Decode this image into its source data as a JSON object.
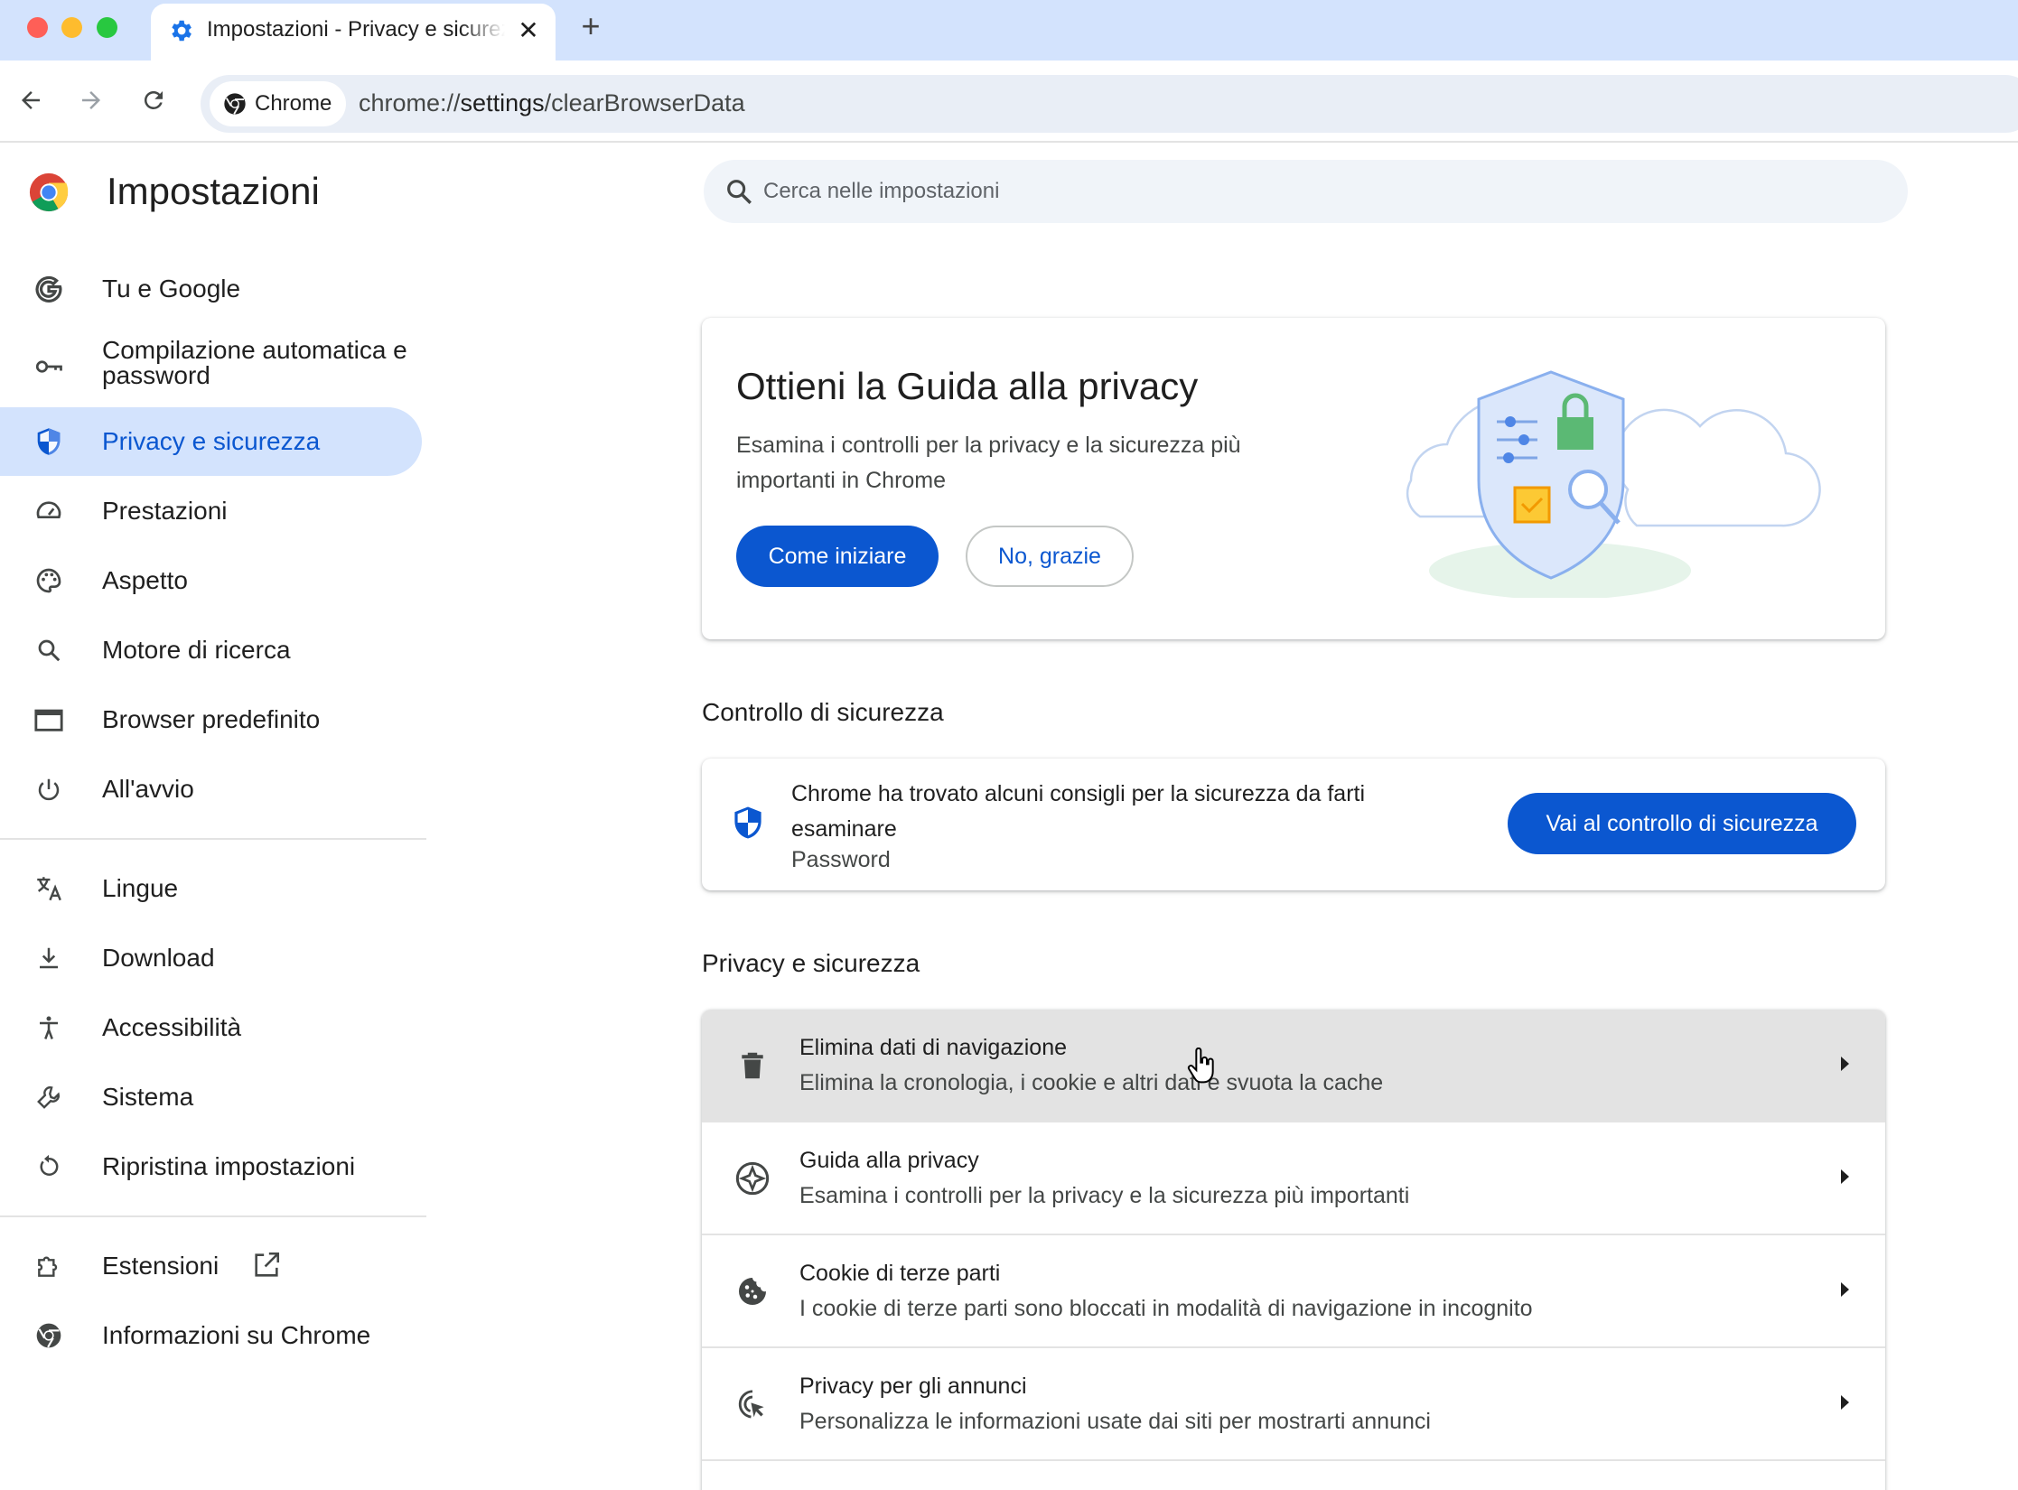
{
  "browser": {
    "tab_title": "Impostazioni - Privacy e sicurezza",
    "chip_label": "Chrome",
    "url_prefix": "chrome://",
    "url_host": "settings",
    "url_path": "/clearBrowserData"
  },
  "app": {
    "title": "Impostazioni"
  },
  "search": {
    "placeholder": "Cerca nelle impostazioni"
  },
  "sidebar": {
    "items": [
      {
        "label": "Tu e Google",
        "icon": "google-icon"
      },
      {
        "label": "Compilazione automatica e password",
        "icon": "key-icon"
      },
      {
        "label": "Privacy e sicurezza",
        "icon": "shield-icon",
        "active": true
      },
      {
        "label": "Prestazioni",
        "icon": "speedometer-icon"
      },
      {
        "label": "Aspetto",
        "icon": "palette-icon"
      },
      {
        "label": "Motore di ricerca",
        "icon": "search-icon"
      },
      {
        "label": "Browser predefinito",
        "icon": "browser-window-icon"
      },
      {
        "label": "All'avvio",
        "icon": "power-icon"
      },
      {
        "label": "Lingue",
        "icon": "translate-icon"
      },
      {
        "label": "Download",
        "icon": "download-icon"
      },
      {
        "label": "Accessibilità",
        "icon": "accessibility-icon"
      },
      {
        "label": "Sistema",
        "icon": "wrench-icon"
      },
      {
        "label": "Ripristina impostazioni",
        "icon": "reset-icon"
      },
      {
        "label": "Estensioni",
        "icon": "puzzle-icon"
      },
      {
        "label": "Informazioni su Chrome",
        "icon": "chrome-icon"
      }
    ]
  },
  "promo": {
    "title": "Ottieni la Guida alla privacy",
    "description": "Esamina i controlli per la privacy e la sicurezza più importanti in Chrome",
    "primary_button": "Come iniziare",
    "secondary_button": "No, grazie"
  },
  "safety_check": {
    "heading": "Controllo di sicurezza",
    "message": "Chrome ha trovato alcuni consigli per la sicurezza da farti esaminare",
    "sub": "Password",
    "button": "Vai al controllo di sicurezza"
  },
  "privacy": {
    "heading": "Privacy e sicurezza",
    "rows": [
      {
        "title": "Elimina dati di navigazione",
        "sub": "Elimina la cronologia, i cookie e altri dati e svuota la cache",
        "icon": "trash-icon"
      },
      {
        "title": "Guida alla privacy",
        "sub": "Esamina i controlli per la privacy e la sicurezza più importanti",
        "icon": "compass-icon"
      },
      {
        "title": "Cookie di terze parti",
        "sub": "I cookie di terze parti sono bloccati in modalità di navigazione in incognito",
        "icon": "cookie-icon"
      },
      {
        "title": "Privacy per gli annunci",
        "sub": "Personalizza le informazioni usate dai siti per mostrarti annunci",
        "icon": "ads-icon"
      }
    ]
  },
  "colors": {
    "accent": "#0b57d0",
    "active_bg": "#d3e3fd",
    "hover_row": "#e3e3e3"
  }
}
